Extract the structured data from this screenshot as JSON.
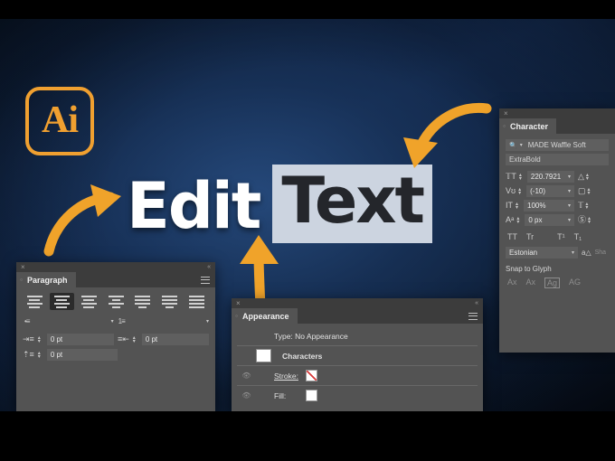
{
  "hero": {
    "logo_text": "Ai",
    "word_one": "Edit",
    "word_two": "Text"
  },
  "arrows": [
    {
      "name": "arrow-to-edit",
      "direction": "up-right",
      "color": "#f0a32a"
    },
    {
      "name": "arrow-to-appearance",
      "direction": "up",
      "color": "#f0a32a"
    },
    {
      "name": "arrow-to-text",
      "direction": "down-left",
      "color": "#f0a32a"
    }
  ],
  "paragraph_panel": {
    "tab_label": "Paragraph",
    "close_icon": "×",
    "collapse_icon": "«",
    "menu_icon": "panel-menu-icon",
    "align_buttons": [
      {
        "name": "align-left",
        "active": false
      },
      {
        "name": "align-center",
        "active": true
      },
      {
        "name": "align-right",
        "active": false
      },
      {
        "name": "justify-last-left",
        "active": false
      },
      {
        "name": "justify-last-center",
        "active": false
      },
      {
        "name": "justify-last-right",
        "active": false
      },
      {
        "name": "justify-all",
        "active": false
      }
    ],
    "list_buttons": [
      {
        "name": "bullet-list",
        "label": "•≡"
      },
      {
        "name": "numbered-list",
        "label": "1≡"
      }
    ],
    "indent_left": "0 pt",
    "indent_right": "0 pt",
    "space_before": "0 pt"
  },
  "appearance_panel": {
    "tab_label": "Appearance",
    "close_icon": "×",
    "collapse_icon": "«",
    "type_row": "Type: No Appearance",
    "characters_row": "Characters",
    "stroke_label": "Stroke:",
    "fill_label": "Fill:",
    "stroke_swatch": "none",
    "fill_swatch": "#ffffff"
  },
  "character_panel": {
    "tab_label": "Character",
    "close_icon": "×",
    "collapse_icon": "«",
    "font_family": "MADE Waffle Soft",
    "font_style": "ExtraBold",
    "font_size": "220.7921",
    "leading": "",
    "kerning": "(-10)",
    "tracking": "",
    "vertical_scale": "100%",
    "horizontal_scale": "",
    "baseline_shift": "0 px",
    "rotation": "",
    "case_buttons": [
      "TT",
      "Tr",
      "T¹",
      "T₁"
    ],
    "language": "Estonian",
    "anti_alias": "Sha",
    "snap_title": "Snap to Glyph",
    "snap_icons": [
      "Ax",
      "Ax",
      "Ag",
      "AG"
    ]
  }
}
